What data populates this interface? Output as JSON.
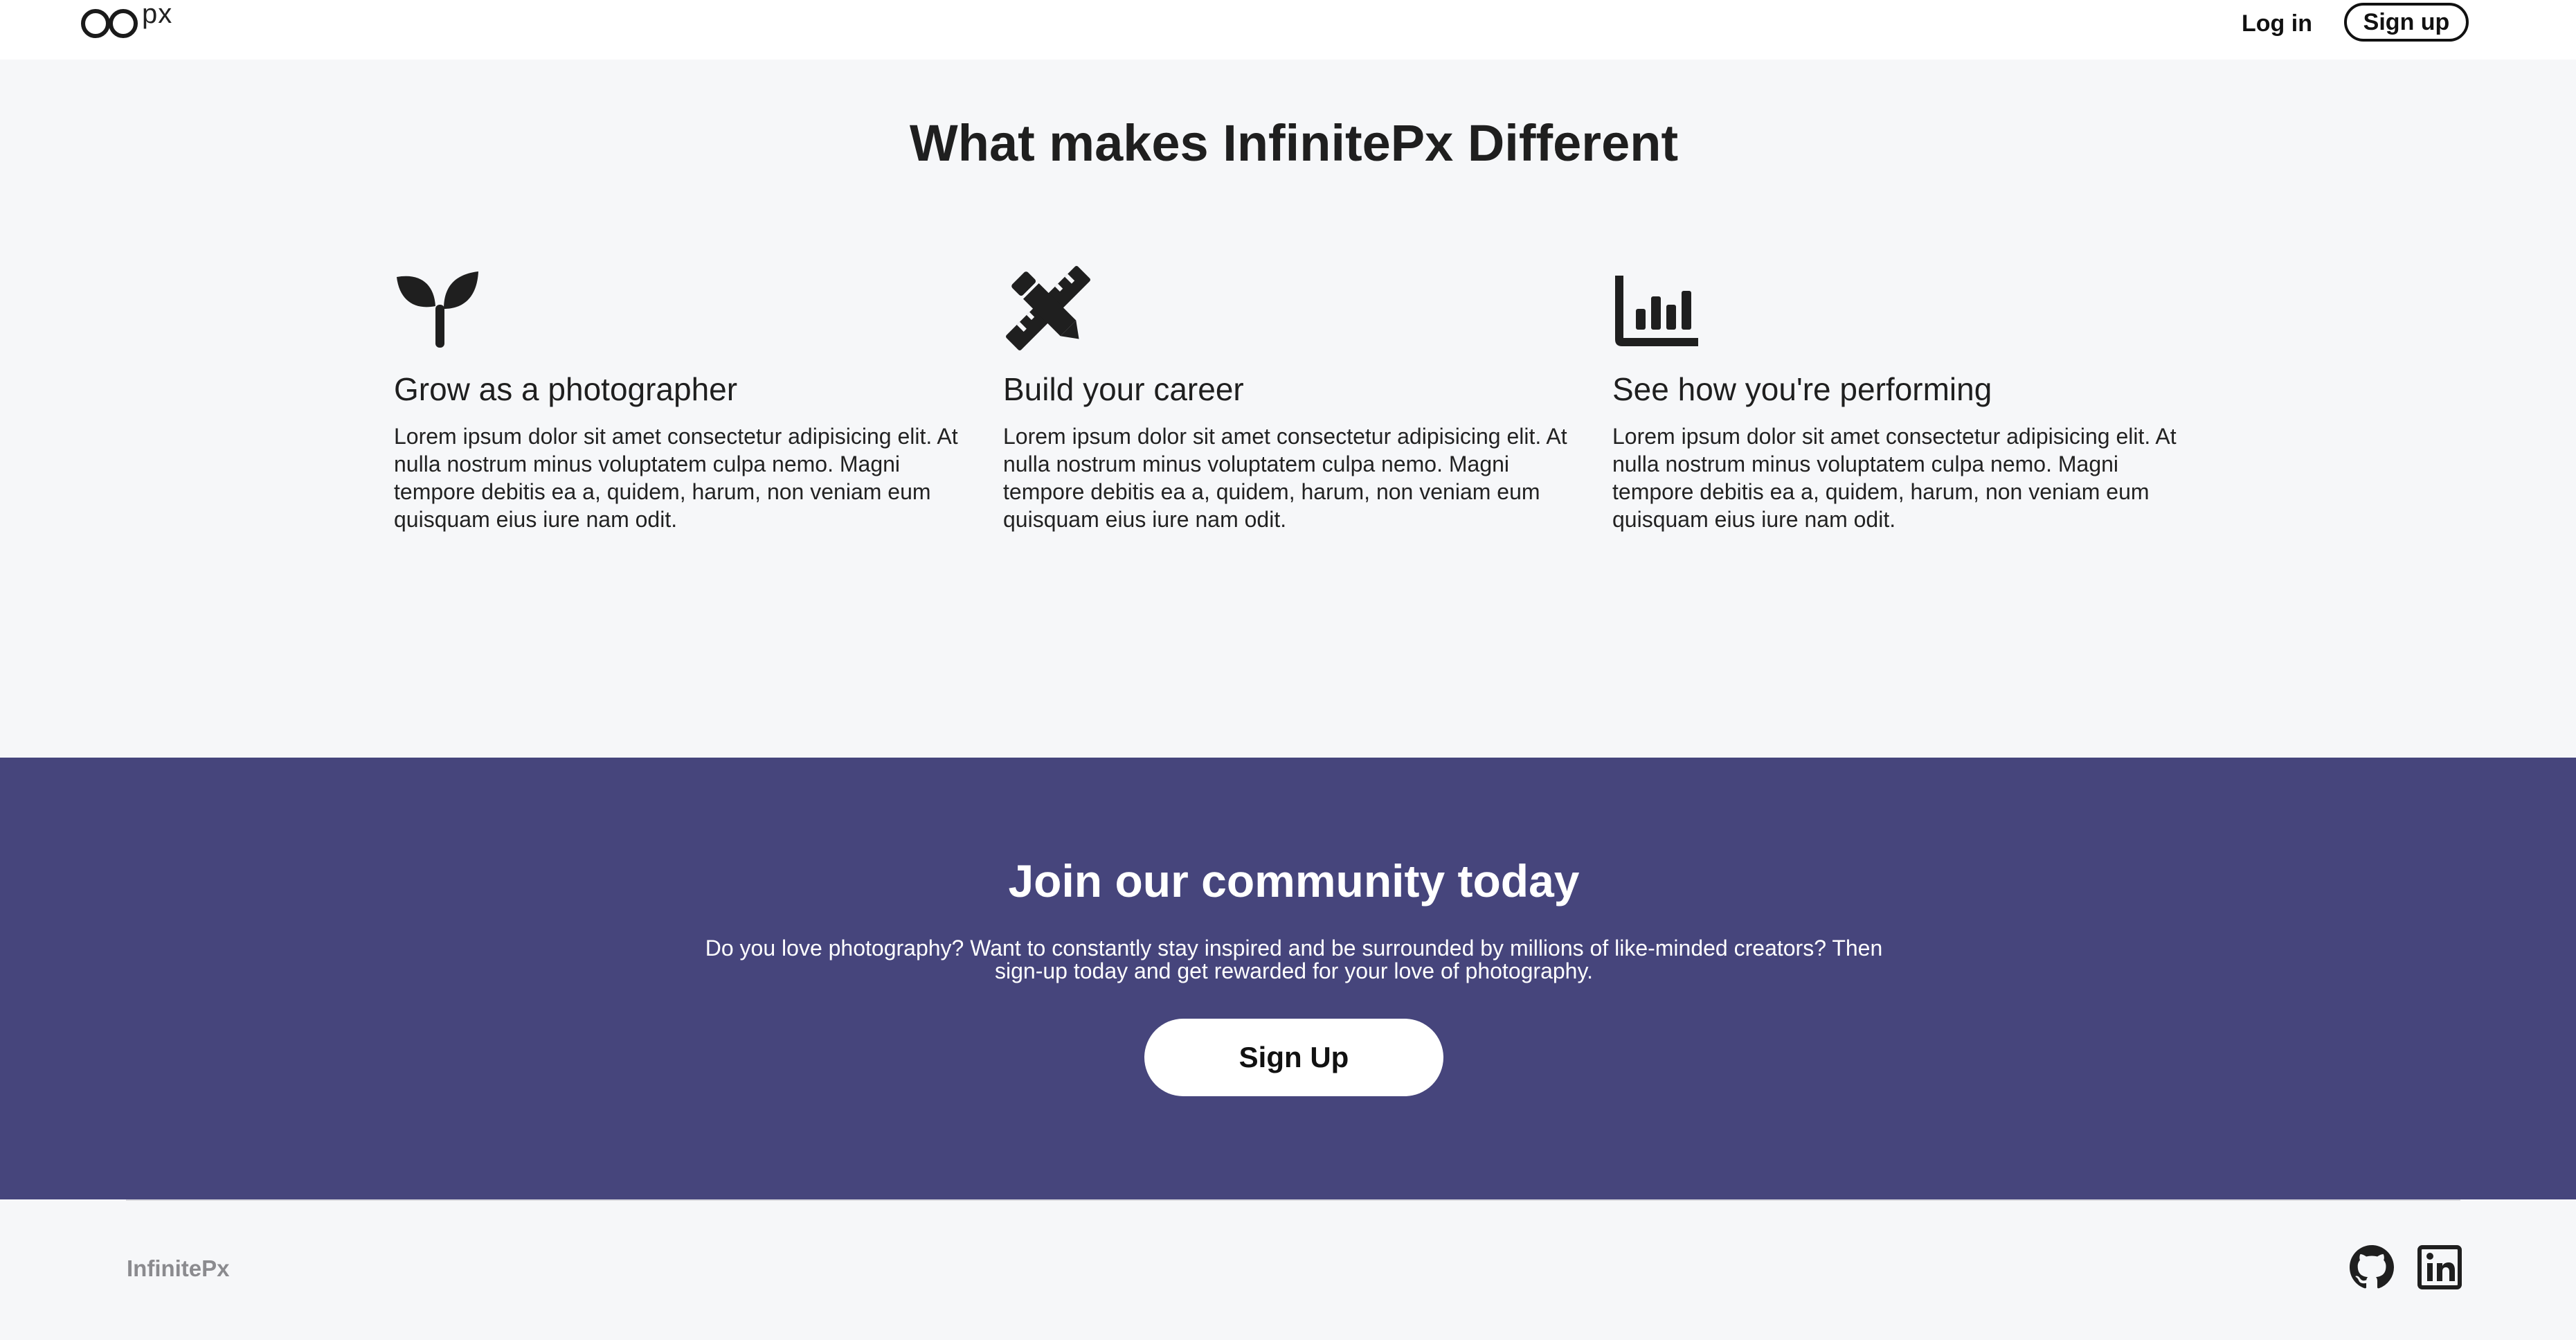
{
  "header": {
    "logo_text": "px",
    "login_label": "Log in",
    "signup_label": "Sign up"
  },
  "features": {
    "title": "What makes InfinitePx Different",
    "items": [
      {
        "icon": "sprout-icon",
        "title": "Grow as a photographer",
        "text": "Lorem ipsum dolor sit amet consectetur adipisicing elit. At nulla nostrum minus voluptatem culpa nemo. Magni tempore debitis ea a, quidem, harum, non veniam eum quisquam eius iure nam odit."
      },
      {
        "icon": "pencil-ruler-icon",
        "title": "Build your career",
        "text": "Lorem ipsum dolor sit amet consectetur adipisicing elit. At nulla nostrum minus voluptatem culpa nemo. Magni tempore debitis ea a, quidem, harum, non veniam eum quisquam eius iure nam odit."
      },
      {
        "icon": "bar-chart-icon",
        "title": "See how you're performing",
        "text": "Lorem ipsum dolor sit amet consectetur adipisicing elit. At nulla nostrum minus voluptatem culpa nemo. Magni tempore debitis ea a, quidem, harum, non veniam eum quisquam eius iure nam odit."
      }
    ]
  },
  "cta": {
    "title": "Join our community today",
    "text": "Do you love photography? Want to constantly stay inspired and be surrounded by millions of like-minded creators? Then sign-up today and get rewarded for your love of photography.",
    "button_label": "Sign Up",
    "background": "#46457c"
  },
  "footer": {
    "brand": "InfinitePx",
    "icons": [
      "github-icon",
      "linkedin-icon"
    ]
  }
}
